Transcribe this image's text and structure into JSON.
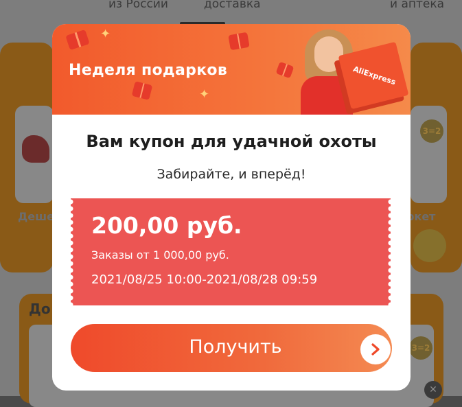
{
  "background": {
    "tabs": [
      "из России",
      "доставка",
      "и аптека"
    ],
    "left_card_label": "Деше",
    "right_card_label": "ркет",
    "bottom_card_title": "До",
    "badge_text": "3=2"
  },
  "modal": {
    "banner_title": "Неделя подарков",
    "banner_brand": "AliExpress",
    "title": "Вам купон для удачной охоты",
    "subtitle": "Забирайте, и вперёд!",
    "coupon": {
      "amount": "200,00 руб.",
      "min_order": "Заказы от 1 000,00 руб.",
      "period": "2021/08/25 10:00-2021/08/28 09:59"
    },
    "button_label": "Получить"
  },
  "colors": {
    "accent": "#ef4a2b",
    "coupon_bg": "#ec5553",
    "banner_orange": "#f4733a"
  },
  "icons": {
    "button_icon": "chevron-right-icon",
    "close_icon": "close-icon"
  }
}
